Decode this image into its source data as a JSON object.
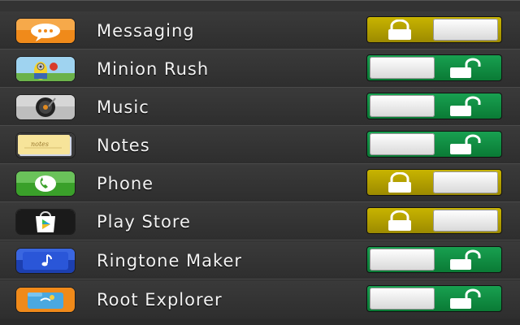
{
  "apps": [
    {
      "label": "Messaging",
      "icon": "messaging-icon",
      "state": "locked"
    },
    {
      "label": "Minion Rush",
      "icon": "minion-rush-icon",
      "state": "unlocked"
    },
    {
      "label": "Music",
      "icon": "music-icon",
      "state": "unlocked"
    },
    {
      "label": "Notes",
      "icon": "notes-icon",
      "state": "unlocked"
    },
    {
      "label": "Phone",
      "icon": "phone-icon",
      "state": "locked"
    },
    {
      "label": "Play Store",
      "icon": "play-store-icon",
      "state": "locked"
    },
    {
      "label": "Ringtone Maker",
      "icon": "ringtone-maker-icon",
      "state": "unlocked"
    },
    {
      "label": "Root Explorer",
      "icon": "root-explorer-icon",
      "state": "unlocked"
    }
  ],
  "colors": {
    "locked": "#b8a400",
    "unlocked": "#119a45",
    "row_text": "#f2f2f2"
  }
}
